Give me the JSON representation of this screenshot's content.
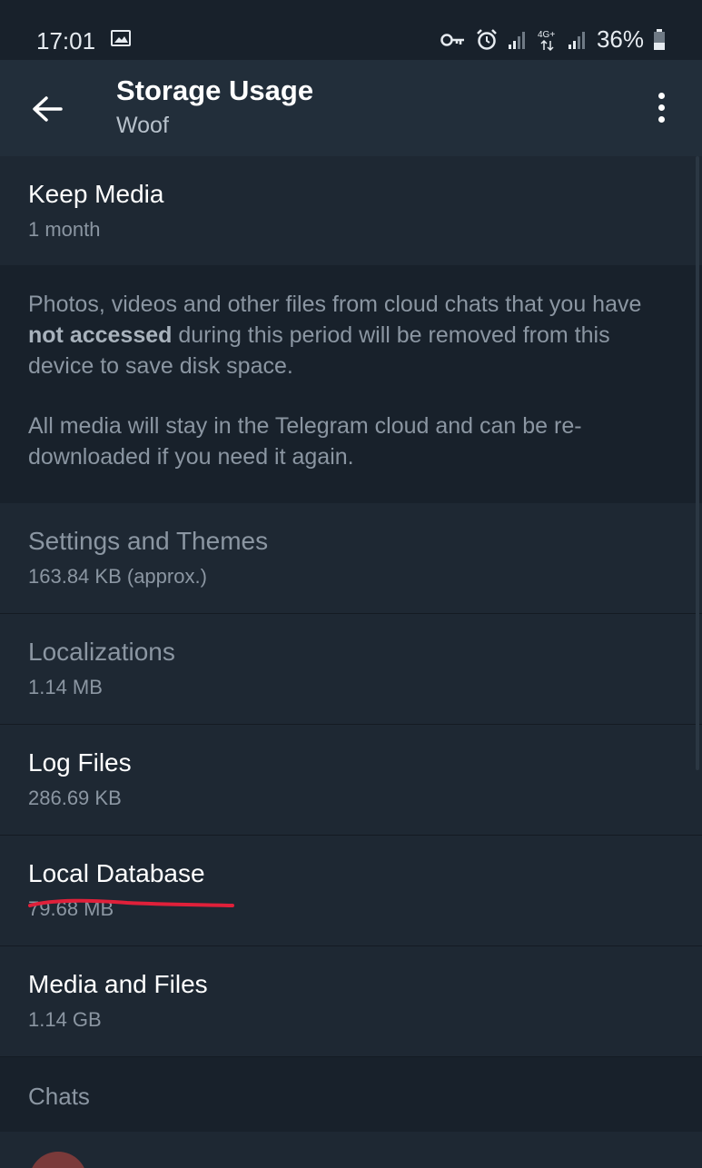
{
  "status_bar": {
    "time": "17:01",
    "battery": "36%"
  },
  "app_bar": {
    "title": "Storage Usage",
    "subtitle": "Woof"
  },
  "keep_media": {
    "title": "Keep Media",
    "value": "1 month"
  },
  "info": {
    "p1_before": "Photos, videos and other files from cloud chats that you have ",
    "p1_bold": "not accessed",
    "p1_after": " during this period will be removed from this device to save disk space.",
    "p2": "All media will stay in the Telegram cloud and can be re-downloaded if you need it again."
  },
  "items": [
    {
      "title": "Settings and Themes",
      "size": "163.84 KB (approx.)"
    },
    {
      "title": "Localizations",
      "size": "1.14 MB"
    },
    {
      "title": "Log Files",
      "size": "286.69 KB"
    },
    {
      "title": "Local Database",
      "size": "79.68 MB"
    },
    {
      "title": "Media and Files",
      "size": "1.14 GB"
    }
  ],
  "section": {
    "chats_label": "Chats"
  },
  "colors": {
    "background": "#18212b",
    "card": "#1e2833",
    "app_bar": "#222e3a",
    "annotation": "#e0203a"
  }
}
